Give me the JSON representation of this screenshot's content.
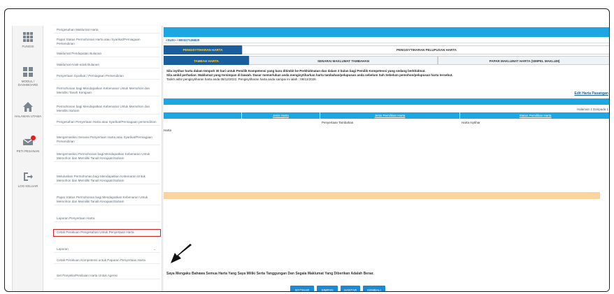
{
  "rail": {
    "items": [
      {
        "label": "FUNGSI",
        "icon": "grid-icon"
      },
      {
        "label": "MODUL / DASHBOARD",
        "icon": "dashboard-icon"
      },
      {
        "label": "HALAMAN UTAMA",
        "icon": "home-icon"
      },
      {
        "label": "PETI PESANAN",
        "icon": "mail-icon"
      },
      {
        "label": "LOG KELUAR",
        "icon": "logout-icon"
      }
    ]
  },
  "menu": {
    "items": [
      "Pengesahan Maklumat Harta",
      "Papar Status Permohonan Harta atau Syarikat/Perniagaan Persendirian",
      "Maklumat Pendapatan Bulanan",
      "Maklumat Anak-anak Bulanan",
      "Penyertaan Syarikat / Perniagaan Persendirian",
      "Permohonan bagi Mendapatkan Kebenaran Untuk Memohon dan Memiliki Tanah Kerajaan",
      "Permohonan bagi Mendapatkan Kebenaran Untuk Memohon dan Memiliki Saham",
      "Pengesahan Penyertaan Harta atau Syarikat/Perniagaan persendirian",
      "Mengemaskini Senarai Penyertaan Harta atau Syarikat/Perniagaan Persendirian",
      "Mengemaskini Permohonan bagi Mendapatkan Kebenaran Untuk Memohon dan Memiliki Tanah Kerajaan/Saham",
      "Meluluskan Permohonan bagi Mendapatkan Kebenaran Untuk Memohon dan Memiliki Tanah Kerajaan/Saham",
      "Papar Status Permohonan bagi Mendapatkan Kebenaran Untuk Memohon dan Memiliki Tanah Kerajaan/Saham",
      "Laporan Penyertaan Harta",
      "Cetak Perakuan Pengesahan Untuk Penyertaan Harta",
      "Laporan",
      "Cetak Perakuan Kompetensi untuk Paparan Penyertaan Harta",
      "Set Penyelia/Penilaian Harta Untuk Agensi"
    ],
    "highlight_index": 13
  },
  "content": {
    "id_line": "<SUS> / 800327136820",
    "tab_row1": [
      "PENGISYTIHARAN HARTA",
      "PENGISYTIHARAN PELUPUSAN HARTA"
    ],
    "tab_row2": [
      "TAMBAH HARTA",
      "SENARAI MAKLUMAT TAMBAHAN",
      "PAPAR MAKLUMAT HARTA (SIMPEL MAKLUM)"
    ],
    "notice_line1": "Sila isytihar harta dalam tempoh 30 hari untuk Pemilik Kompetensi yang baru ditimbit ke Perkhidmatan dan dalam 3 bulan bagi Pemilik Kompetensi yang sedang berkhidmat.",
    "notice_line2": "Sila ambil perhatian: Maklumat yang tersimpan di bawah. Dasar memerlukan anda mengisytiharkan harta tambahan/pelupusan anda sebelum Sah Sebelum pemohon/pelupusan harta tersebut.",
    "notice_line3": "Tarikh akhir pengisytiharan harta anda 08/12/2022. Pengisytiharan harta anda sampai ini ialah : 08/12/2026.",
    "link_text": "Edit Harta Pasangan",
    "page_info": "Halaman 1 Daripada 1",
    "table_headers": [
      "Jenis Harta",
      "Jenis Pemilikan Harta",
      "Status Pemilikan Harta"
    ],
    "row_values": [
      "Penyertaan Tambahan",
      "Harta Isytihar"
    ],
    "partial_text": "Harta",
    "question": "Saya Mengaku Bahawa Semua Harta Yang Saya Miliki Serta Tanggungan Dan Segala Maklumat Yang Diberikan Adalah Benar.",
    "buttons": [
      "ISYTIHAR",
      "SIMPAN",
      "HANTAR",
      "KEMBALI"
    ]
  },
  "colors": {
    "accent": "#1ca7e2",
    "tab_active": "#1b5e9e",
    "tab_active_text": "#ffd84d",
    "orange_row": "#fbd39e",
    "highlight_border": "#d02323"
  }
}
